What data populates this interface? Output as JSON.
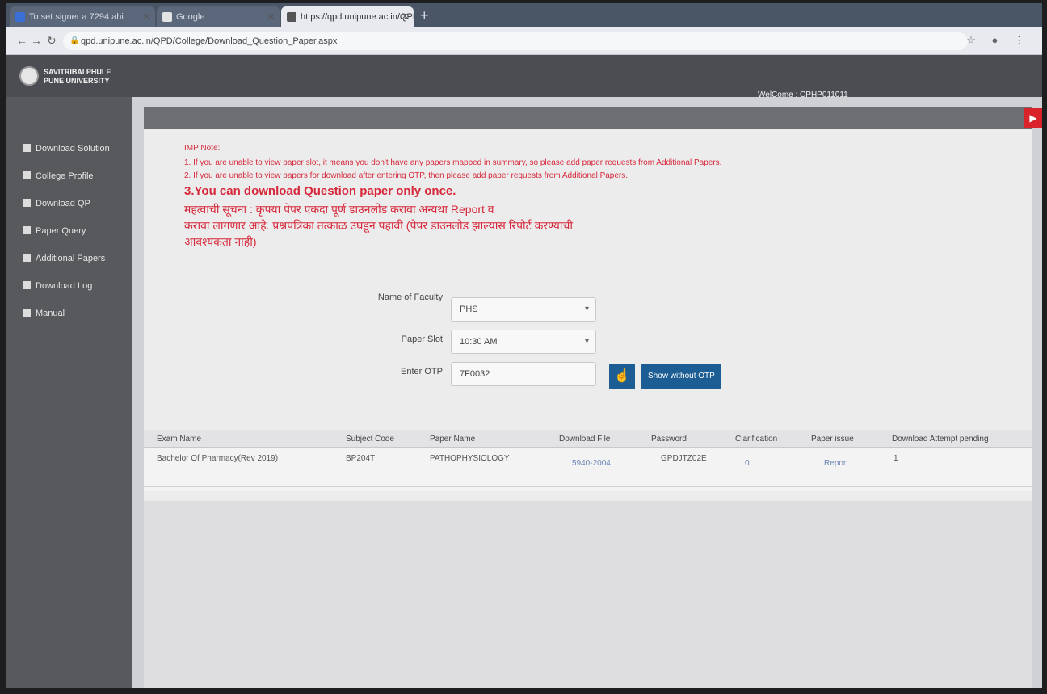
{
  "browser": {
    "tabs": [
      {
        "label": "To set signer a 7294 ahi"
      },
      {
        "label": "Google"
      },
      {
        "label": "https://qpd.unipune.ac.in/QPD/"
      }
    ],
    "new_tab": "+",
    "url": "qpd.unipune.ac.in/QPD/College/Download_Question_Paper.aspx"
  },
  "app": {
    "logo": {
      "line1": "SAVITRIBAI PHULE",
      "line2": "PUNE UNIVERSITY"
    },
    "welcome": "WelCome : CPHP011011",
    "logout_icon": "power-icon"
  },
  "sidebar": {
    "items": [
      {
        "label": "Download Solution"
      },
      {
        "label": "College Profile"
      },
      {
        "label": "Download QP"
      },
      {
        "label": "Paper Query"
      },
      {
        "label": "Additional Papers"
      },
      {
        "label": "Download Log"
      },
      {
        "label": "Manual"
      }
    ]
  },
  "notice": {
    "heading": "IMP Note:",
    "line1": "1. If you are unable to view paper slot, it means you don't have any papers mapped in summary, so please add paper requests from Additional Papers.",
    "line2": "2. If you are unable to view papers for download after entering OTP, then please add paper requests from Additional Papers.",
    "line3": "3.You can download Question paper only once.",
    "hindi1": "महत्वाची सूचना : कृपया पेपर एकदा पूर्ण डाउनलोड करावा अन्यथा Report व",
    "hindi2": "करावा लागणार आहे. प्रश्नपत्रिका तत्काळ उघडून पहावी (पेपर डाउनलोड झाल्यास रिपोर्ट करण्याची",
    "hindi3": "आवश्यकता नाही)"
  },
  "form": {
    "faculty_label": "Name of Faculty",
    "faculty_value": "PHS",
    "slot_label": "Paper Slot",
    "slot_value": "10:30 AM",
    "otp_label": "Enter OTP",
    "otp_value": "7F0032",
    "show_button": "Show without OTP"
  },
  "table": {
    "headers": [
      "Exam Name",
      "Subject Code",
      "Paper Name",
      "Download File",
      "Password",
      "Clarification",
      "Paper issue",
      "Download Attempt pending"
    ],
    "rows": [
      [
        "Bachelor Of Pharmacy(Rev 2019)",
        "BP204T",
        "PATHOPHYSIOLOGY",
        "5940-2004",
        "GPDJTZ02E",
        "0",
        "Report",
        "1"
      ]
    ]
  }
}
